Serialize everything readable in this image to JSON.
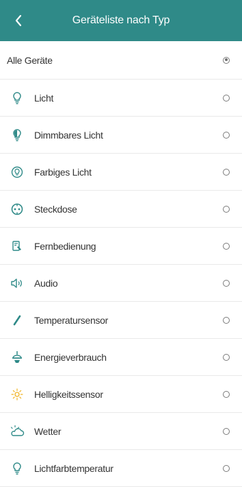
{
  "header": {
    "title": "Geräteliste nach Typ",
    "back_icon": "chevron-left-icon"
  },
  "colors": {
    "header_bg": "#2f8a88",
    "icon_accent": "#2f8a88"
  },
  "list": {
    "all_label": "Alle Geräte",
    "selected": "all",
    "items": [
      {
        "label": "Licht",
        "icon": "bulb-icon"
      },
      {
        "label": "Dimmbares Licht",
        "icon": "dimmable-bulb-icon"
      },
      {
        "label": "Farbiges Licht",
        "icon": "color-bulb-icon"
      },
      {
        "label": "Steckdose",
        "icon": "socket-icon"
      },
      {
        "label": "Fernbedienung",
        "icon": "remote-icon"
      },
      {
        "label": "Audio",
        "icon": "speaker-icon"
      },
      {
        "label": "Temperatursensor",
        "icon": "thermometer-icon"
      },
      {
        "label": "Energieverbrauch",
        "icon": "energy-icon"
      },
      {
        "label": "Helligkeitssensor",
        "icon": "brightness-icon"
      },
      {
        "label": "Wetter",
        "icon": "weather-icon"
      },
      {
        "label": "Lichtfarbtemperatur",
        "icon": "color-temperature-icon"
      }
    ]
  }
}
